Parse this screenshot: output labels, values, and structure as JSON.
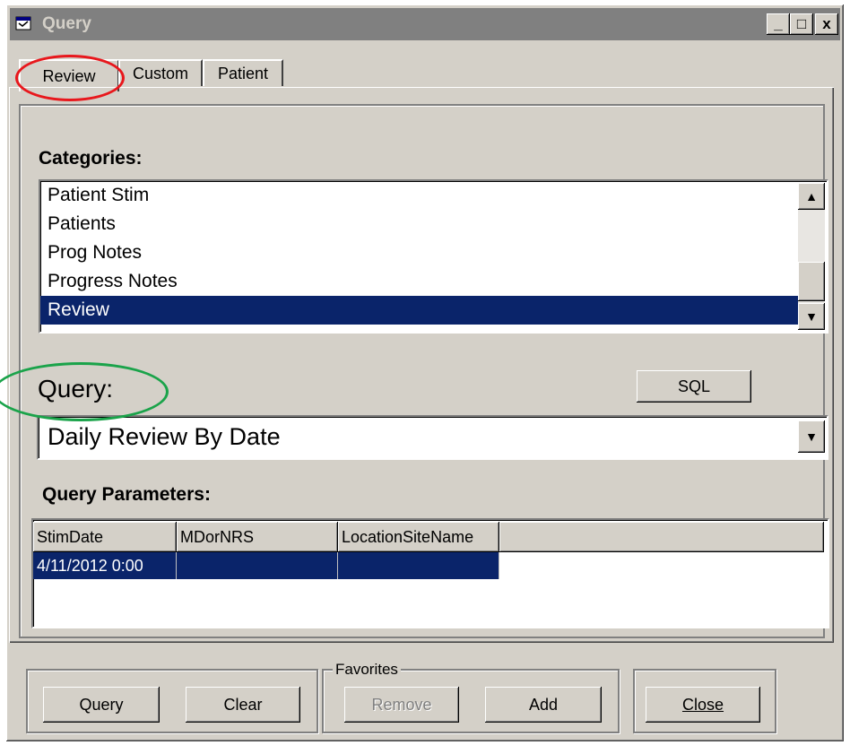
{
  "window": {
    "title": "Query",
    "controls": {
      "minimize": "_",
      "maximize": "□",
      "close": "x"
    }
  },
  "tabs": [
    {
      "label": "Review",
      "active": true
    },
    {
      "label": "Custom",
      "active": false
    },
    {
      "label": "Patient",
      "active": false
    }
  ],
  "categories": {
    "label": "Categories:",
    "items": [
      "Patient Stim",
      "Patients",
      "Prog Notes",
      "Progress Notes",
      "Review"
    ],
    "selected": "Review"
  },
  "query": {
    "label": "Query:",
    "sql_button": "SQL",
    "selected": "Daily Review By Date"
  },
  "parameters": {
    "label": "Query Parameters:",
    "columns": [
      "StimDate",
      "MDorNRS",
      "LocationSiteName"
    ],
    "rows": [
      [
        "4/11/2012 0:00",
        "",
        ""
      ]
    ]
  },
  "footer": {
    "query_button": "Query",
    "clear_button": "Clear",
    "favorites_label": "Favorites",
    "remove_button": "Remove",
    "add_button": "Add",
    "close_button": "Close"
  },
  "colors": {
    "annotation_red": "#e8171c",
    "annotation_green": "#1aa34a",
    "selection": "#0a246a"
  }
}
